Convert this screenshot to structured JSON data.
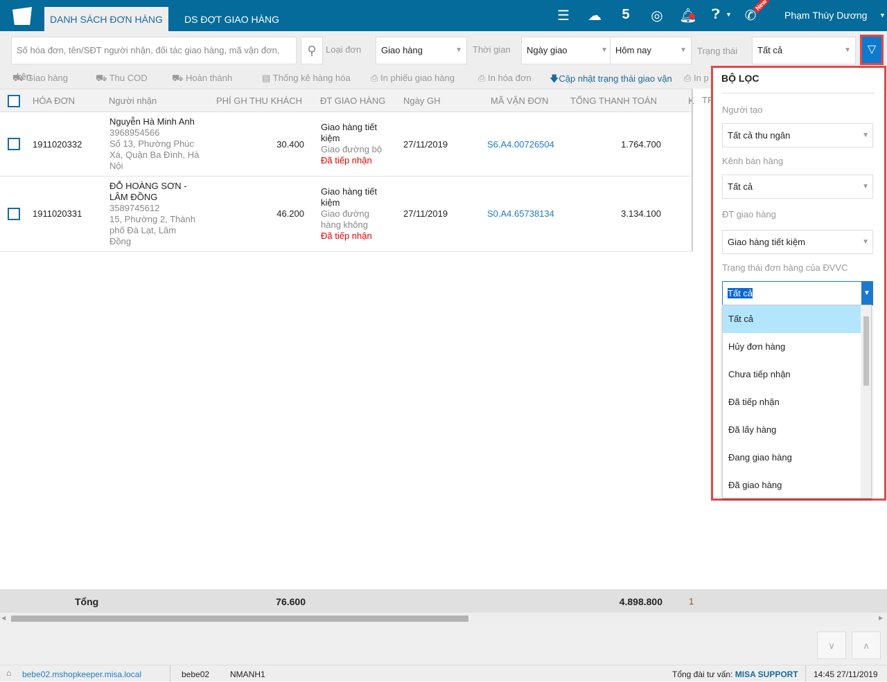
{
  "header": {
    "tabs": [
      "DANH SÁCH ĐƠN HÀNG",
      "DS ĐỢT GIAO HÀNG"
    ],
    "user": "Phạm Thùy Dương",
    "new_badge": "New",
    "brand_color": "#046b9a"
  },
  "search": {
    "placeholder": "Số hóa đơn, tên/SĐT người nhận, đối tác giao hàng, mã vận đơn, kên"
  },
  "filters": {
    "type_label": "Loại đơn",
    "type_value": "Giao hàng",
    "time_label": "Thời gian",
    "time_field": "Ngày giao",
    "time_range": "Hôm nay",
    "status_label": "Trạng thái",
    "status_value": "Tất cả"
  },
  "actions": [
    "Giao hàng",
    "Thu COD",
    "Hoàn thành",
    "Thống kê hàng hóa",
    "In phiếu giao hàng",
    "In hóa đơn",
    "Cập nhật trạng thái giao vận",
    "In p"
  ],
  "columns": [
    "HÓA ĐƠN",
    "Người nhận",
    "PHÍ GH THU KHÁCH",
    "ĐT GIAO HÀNG",
    "Ngày GH",
    "MÃ VẬN ĐƠN",
    "TỔNG THANH TOÁN",
    "K",
    "TR"
  ],
  "rows": [
    {
      "invoice": "1911020332",
      "name": "Nguyễn Hà Minh Anh",
      "phone": "3968954566",
      "address": "Số 13, Phường Phúc Xá, Quận Ba Đình, Hà Nội",
      "fee": "30.400",
      "partner": "Giao hàng tiết kiệm",
      "method": "Giao đường bộ",
      "status": "Đã tiếp nhận",
      "date": "27/11/2019",
      "tracking": "S6.A4.00726504",
      "total": "1.764.700"
    },
    {
      "invoice": "1911020331",
      "name": "ĐỖ HOÀNG SƠN - LÂM ĐỒNG",
      "phone": "3589745612",
      "address": "15, Phường 2, Thành phố Đà Lạt, Lâm Đồng",
      "fee": "46.200",
      "partner": "Giao hàng tiết kiệm",
      "method": "Giao đường hàng không",
      "status": "Đã tiếp nhận",
      "date": "27/11/2019",
      "tracking": "S0.A4.65738134",
      "total": "3.134.100"
    }
  ],
  "totals": {
    "label": "Tổng",
    "fee": "76.600",
    "total": "4.898.800",
    "extra": "1"
  },
  "filter_panel": {
    "title": "BỘ LỌC",
    "creator_label": "Người tạo",
    "creator_value": "Tất cả thu ngân",
    "channel_label": "Kênh bán hàng",
    "channel_value": "Tất cả",
    "partner_label": "ĐT giao hàng",
    "partner_value": "Giao hàng tiết kiệm",
    "carrier_status_label": "Trạng thái đơn hàng của ĐVVC",
    "carrier_status_value": "Tất cả",
    "options": [
      "Tất cả",
      "Hủy đơn hàng",
      "Chưa tiếp nhận",
      "Đã tiếp nhận",
      "Đã lấy hàng",
      "Đang giao hàng",
      "Đã giao hàng"
    ]
  },
  "status_bar": {
    "domain": "bebe02.mshopkeeper.misa.local",
    "shop": "bebe02",
    "user": "NMANH1",
    "support_label": "Tổng đài tư vấn:",
    "support_link": "MISA SUPPORT",
    "datetime": "14:45 27/11/2019"
  }
}
